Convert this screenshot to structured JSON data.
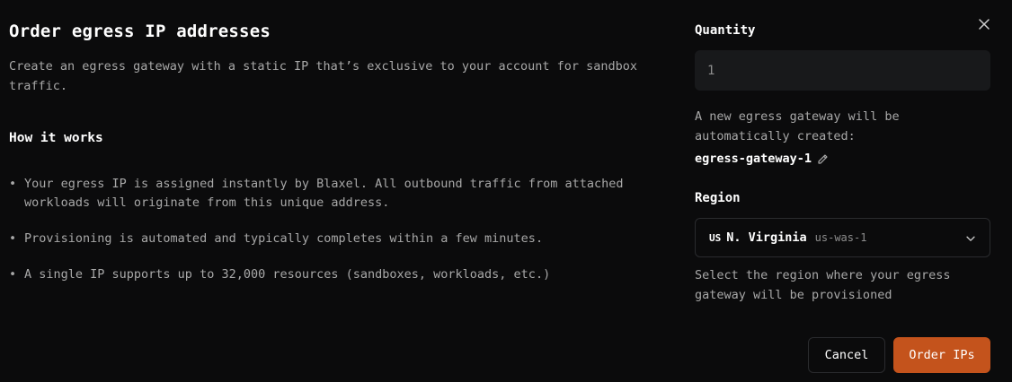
{
  "dialog": {
    "title": "Order egress IP addresses",
    "description": "Create an egress gateway with a static IP that’s exclusive to your account for sandbox traffic.",
    "how_heading": "How it works",
    "bullets": [
      "Your egress IP is assigned instantly by Blaxel. All outbound traffic from attached workloads will originate from this unique address.",
      "Provisioning is automated and typically completes within a few minutes.",
      "A single IP supports up to 32,000 resources (sandboxes, workloads, etc.)"
    ]
  },
  "form": {
    "quantity_label": "Quantity",
    "quantity_value": "1",
    "gateway_hint": "A new egress gateway will be automatically created:",
    "gateway_name": "egress-gateway-1",
    "region_label": "Region",
    "region_flag": "US",
    "region_name": "N. Virginia",
    "region_code": "us-was-1",
    "region_hint": "Select the region where your egress gateway will be provisioned"
  },
  "actions": {
    "cancel_label": "Cancel",
    "order_label": "Order IPs"
  },
  "icons": {
    "close": "close-icon",
    "edit": "pencil-icon",
    "dropdown": "chevron-down-icon"
  },
  "colors": {
    "background": "#0b0b0c",
    "accent": "#c4531c",
    "input_bg": "#18191b",
    "border": "#2a2b2e"
  }
}
